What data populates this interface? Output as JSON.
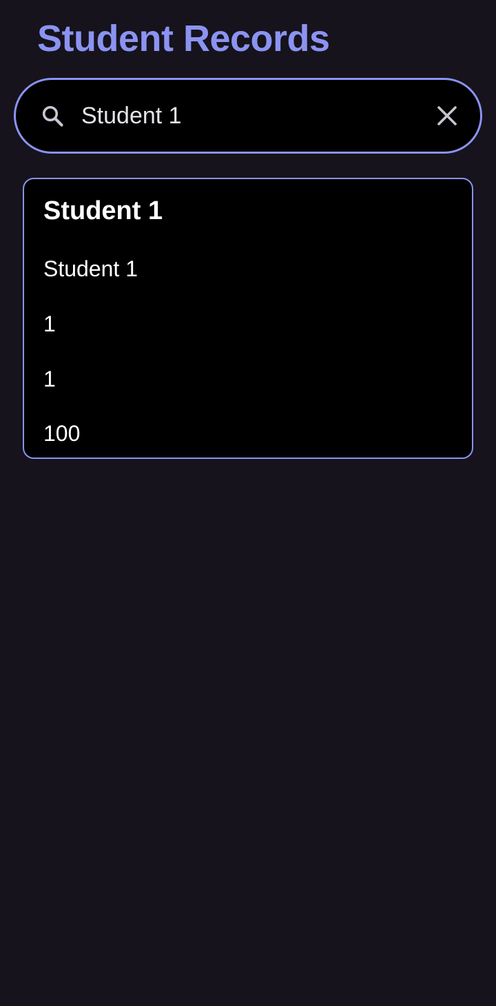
{
  "header": {
    "title": "Student Records"
  },
  "search": {
    "value": "Student 1",
    "icon": "search-icon",
    "clear_icon": "close-icon"
  },
  "records": [
    {
      "title": "Student 1",
      "fields": [
        "Student 1",
        "1",
        "1",
        "100"
      ]
    }
  ],
  "colors": {
    "background": "#16131c",
    "accent": "#8b93f2",
    "card_background": "#000000",
    "text": "#ffffff"
  }
}
